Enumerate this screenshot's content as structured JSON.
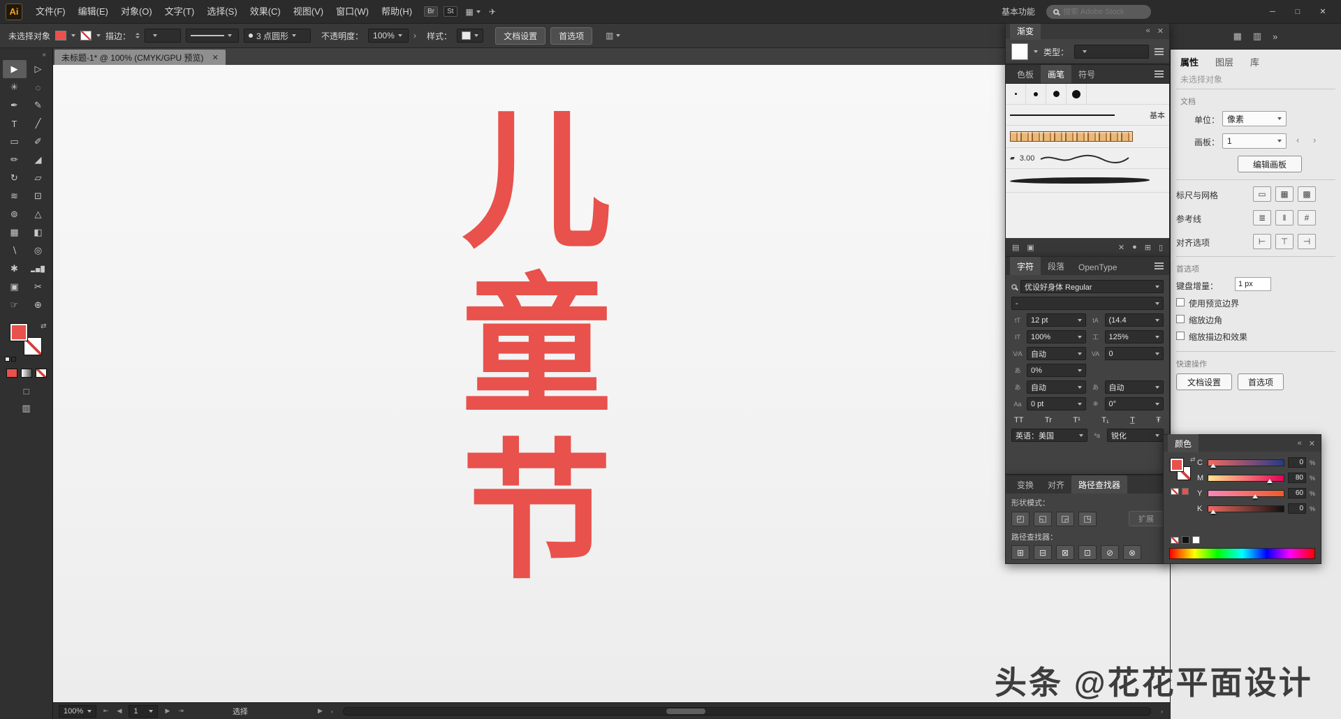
{
  "icons": {
    "minimize": "─",
    "maximize": "□",
    "close": "✕",
    "collapse_left": "«",
    "collapse_right": "»",
    "chevron_left": "‹",
    "chevron_right": "›",
    "flyout": "▶",
    "swap": "⇄",
    "grid": "▦",
    "columns": "▥",
    "share": "✈",
    "nav_first": "⇤",
    "nav_prev": "◀",
    "nav_next": "▶",
    "nav_last": "⇥"
  },
  "menubar": {
    "logo": "Ai",
    "menus": [
      "文件(F)",
      "编辑(E)",
      "对象(O)",
      "文字(T)",
      "选择(S)",
      "效果(C)",
      "视图(V)",
      "窗口(W)",
      "帮助(H)"
    ],
    "bridge": "Br",
    "stock": "St",
    "workspace": "基本功能",
    "search_placeholder": "搜索 Adobe Stock"
  },
  "controlbar": {
    "no_selection": "未选择对象",
    "stroke_label": "描边：",
    "brush_name": "3 点圆形",
    "opacity_label": "不透明度：",
    "opacity_value": "100%",
    "style_label": "样式：",
    "doc_setup_button": "文档设置",
    "preferences_button": "首选项"
  },
  "document_tab": {
    "title": "未标题-1* @ 100% (CMYK/GPU 预览)"
  },
  "toolbar": {
    "tools": [
      {
        "name": "selection",
        "glyph": "▶"
      },
      {
        "name": "direct-selection",
        "glyph": "▷"
      },
      {
        "name": "magic-wand",
        "glyph": "✳"
      },
      {
        "name": "lasso",
        "glyph": "◌"
      },
      {
        "name": "pen",
        "glyph": "✒"
      },
      {
        "name": "curvature",
        "glyph": "✎"
      },
      {
        "name": "type",
        "glyph": "T"
      },
      {
        "name": "line-segment",
        "glyph": "╱"
      },
      {
        "name": "rectangle",
        "glyph": "▭"
      },
      {
        "name": "paintbrush",
        "glyph": "✐"
      },
      {
        "name": "pencil",
        "glyph": "✏"
      },
      {
        "name": "eraser",
        "glyph": "◢"
      },
      {
        "name": "rotate",
        "glyph": "↻"
      },
      {
        "name": "scale",
        "glyph": "▱"
      },
      {
        "name": "width",
        "glyph": "≋"
      },
      {
        "name": "free-transform",
        "glyph": "⊡"
      },
      {
        "name": "shape-builder",
        "glyph": "⊚"
      },
      {
        "name": "perspective-grid",
        "glyph": "△"
      },
      {
        "name": "mesh",
        "glyph": "▦"
      },
      {
        "name": "gradient",
        "glyph": "◧"
      },
      {
        "name": "eyedropper",
        "glyph": "∖"
      },
      {
        "name": "blend",
        "glyph": "◎"
      },
      {
        "name": "symbol-sprayer",
        "glyph": "✱"
      },
      {
        "name": "column-graph",
        "glyph": "▂▅█"
      },
      {
        "name": "artboard",
        "glyph": "▣"
      },
      {
        "name": "slice",
        "glyph": "✂"
      },
      {
        "name": "hand",
        "glyph": "☞"
      },
      {
        "name": "zoom",
        "glyph": "⊕"
      }
    ]
  },
  "canvas": {
    "text": "儿童节",
    "text_color": "#e8514c",
    "watermark": "头条 @花花平面设计"
  },
  "gradient_panel": {
    "title": "渐变",
    "type_label": "类型："
  },
  "brushes_panel": {
    "tabs": [
      "色板",
      "画笔",
      "符号"
    ],
    "basic_label": "基本",
    "brush_size_label": "3.00",
    "footer_icons": [
      {
        "name": "brush-libraries",
        "glyph": "▤"
      },
      {
        "name": "libraries-panel",
        "glyph": "▣"
      },
      {
        "name": "remove-brush-stroke",
        "glyph": "✕"
      },
      {
        "name": "brush-options",
        "glyph": "●"
      },
      {
        "name": "new-brush",
        "glyph": "⊞"
      },
      {
        "name": "delete-brush",
        "glyph": "▯"
      }
    ]
  },
  "character_panel": {
    "tabs": [
      "字符",
      "段落",
      "OpenType"
    ],
    "font_name": "优设好身体 Regular",
    "font_style": "-",
    "size_icon": "tT",
    "size_value": "12 pt",
    "leading_icon": "tA",
    "leading_value": "(14.4",
    "vscale_icon": "IT",
    "vscale_value": "100%",
    "hscale_icon": "工",
    "hscale_value": "125%",
    "kerning_icon": "V∕A",
    "kerning_value": "自动",
    "tracking_icon": "VA",
    "tracking_value": "0",
    "spacing_icon": "あ",
    "spacing_value": "0%",
    "tsume_left_icon": "あ",
    "tsume_left_value": "自动",
    "tsume_right_icon": "あ",
    "tsume_right_value": "自动",
    "baseline_icon": "Aa",
    "baseline_value": "0 pt",
    "rotation_icon": "⊕",
    "rotation_value": "0°",
    "case_buttons": [
      "TT",
      "Tr",
      "T¹",
      "T₁",
      "T̲",
      "Ŧ"
    ],
    "language_value": "英语：美国",
    "aa_icon": "ªa",
    "antialias_value": "锐化"
  },
  "pathfinder_panel": {
    "tabs": [
      "变换",
      "对齐",
      "路径查找器"
    ],
    "shape_mode_label": "形状模式：",
    "expand_button": "扩展",
    "pathfinder_label": "路径查找器：",
    "shape_buttons": [
      {
        "name": "unite",
        "glyph": "◰"
      },
      {
        "name": "minus-front",
        "glyph": "◱"
      },
      {
        "name": "intersect",
        "glyph": "◲"
      },
      {
        "name": "exclude",
        "glyph": "◳"
      }
    ],
    "pf_buttons": [
      {
        "name": "divide",
        "glyph": "⊞"
      },
      {
        "name": "trim",
        "glyph": "⊟"
      },
      {
        "name": "merge",
        "glyph": "⊠"
      },
      {
        "name": "crop",
        "glyph": "⊡"
      },
      {
        "name": "outline",
        "glyph": "⊘"
      },
      {
        "name": "minus-back",
        "glyph": "⊗"
      }
    ]
  },
  "color_panel": {
    "title": "颜色",
    "percent": "%",
    "channels": [
      {
        "label": "C",
        "value": "0",
        "pos": "3%"
      },
      {
        "label": "M",
        "value": "80",
        "pos": "78%"
      },
      {
        "label": "Y",
        "value": "60",
        "pos": "58%"
      },
      {
        "label": "K",
        "value": "0",
        "pos": "3%"
      }
    ]
  },
  "properties_panel": {
    "tabs": [
      "属性",
      "图层",
      "库"
    ],
    "no_selection": "未选择对象",
    "document_label": "文档",
    "unit_label": "单位：",
    "unit_value": "像素",
    "artboard_label": "画板：",
    "artboard_value": "1",
    "edit_artboard_button": "编辑画板",
    "rulers_label": "标尺与网格",
    "guides_label": "参考线",
    "align_label": "对齐选项",
    "prefs_label": "首选项",
    "keyboard_label": "键盘增量：",
    "keyboard_value": "1 px",
    "checkboxes": [
      "使用预览边界",
      "缩放边角",
      "缩放描边和效果"
    ],
    "quick_label": "快速操作",
    "quick_buttons": [
      "文档设置",
      "首选项"
    ],
    "rulers_icons": [
      {
        "name": "show-rulers",
        "glyph": "▭"
      },
      {
        "name": "show-grid",
        "glyph": "▦"
      },
      {
        "name": "show-transparency-grid",
        "glyph": "▩"
      }
    ],
    "guides_icons": [
      {
        "name": "show-guides",
        "glyph": "≣"
      },
      {
        "name": "lock-guides",
        "glyph": "‖"
      },
      {
        "name": "smart-guides",
        "glyph": "#"
      }
    ],
    "align_icons": [
      {
        "name": "snap-to-grid",
        "glyph": "⊢"
      },
      {
        "name": "snap-to-point",
        "glyph": "⊤"
      },
      {
        "name": "snap-to-pixel",
        "glyph": "⊣"
      }
    ]
  },
  "statusbar": {
    "zoom": "100%",
    "artboard": "1",
    "status": "选择"
  }
}
